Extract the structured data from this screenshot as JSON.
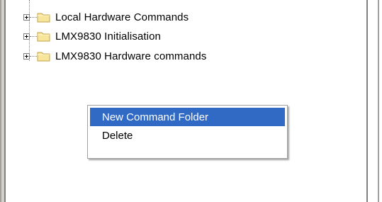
{
  "tree": {
    "nodes": [
      {
        "label": "Local Hardware Commands",
        "icon": "folder-icon",
        "expanded": false
      },
      {
        "label": "LMX9830 Initialisation",
        "icon": "folder-icon",
        "expanded": false
      },
      {
        "label": "LMX9830 Hardware commands",
        "icon": "folder-icon",
        "expanded": false
      }
    ]
  },
  "context_menu": {
    "items": [
      {
        "label": "New Command Folder",
        "selected": true
      },
      {
        "label": "Delete",
        "selected": false
      }
    ]
  },
  "colors": {
    "selection": "#316ac5",
    "folder_fill": "#f8e59c",
    "folder_stroke": "#c2a24a"
  }
}
